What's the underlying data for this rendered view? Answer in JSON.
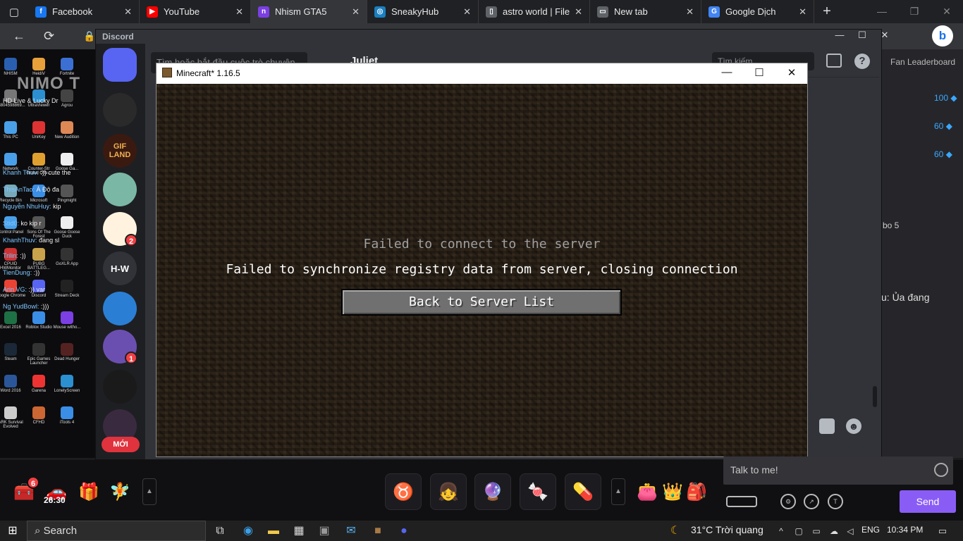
{
  "browser": {
    "tabs": [
      {
        "title": "Facebook",
        "icon": "facebook-icon",
        "color": "#1877f2",
        "glyph": "f"
      },
      {
        "title": "YouTube",
        "icon": "youtube-icon",
        "color": "#ff0000",
        "glyph": "▶"
      },
      {
        "title": "Nhism GTA5",
        "icon": "nimo-icon",
        "color": "#7b3fe4",
        "glyph": "n",
        "active": true
      },
      {
        "title": "SneakyHub",
        "icon": "sneakyhub-icon",
        "color": "#1a7fc1",
        "glyph": "◎"
      },
      {
        "title": "astro world | File",
        "icon": "document-icon",
        "color": "#5f6368",
        "glyph": "▯"
      },
      {
        "title": "New tab",
        "icon": "newtab-icon",
        "color": "#5f6368",
        "glyph": "▭"
      },
      {
        "title": "Google Dịch",
        "icon": "google-translate-icon",
        "color": "#4285f4",
        "glyph": "G"
      }
    ]
  },
  "nimo": {
    "logo": "NIMO T",
    "desktop_icons": [
      {
        "label": "NHISM",
        "c": "#2a5fb0"
      },
      {
        "label": "HeidiV",
        "c": "#e8a03a"
      },
      {
        "label": "Fortnite",
        "c": "#3b6fd4"
      },
      {
        "label": "z3804598869...",
        "c": "#777"
      },
      {
        "label": "UltraViewer",
        "c": "#2b8fd0"
      },
      {
        "label": "Agrou",
        "c": "#444"
      },
      {
        "label": "This PC",
        "c": "#4aa0e8"
      },
      {
        "label": "UniKey",
        "c": "#d33"
      },
      {
        "label": "New Audition",
        "c": "#d85"
      },
      {
        "label": "Network",
        "c": "#4aa0e8"
      },
      {
        "label": "Counter-Str Global Offe...",
        "c": "#e0a030"
      },
      {
        "label": "Goose Ga...",
        "c": "#eee"
      },
      {
        "label": "Recycle Bin",
        "c": "#7ab"
      },
      {
        "label": "Microsoft",
        "c": "#3a8ee6"
      },
      {
        "label": "Pingmight",
        "c": "#555"
      },
      {
        "label": "Control Panel",
        "c": "#4aa0e8"
      },
      {
        "label": "Sons Of The Forest",
        "c": "#555"
      },
      {
        "label": "Goose Goose Duck",
        "c": "#eee"
      },
      {
        "label": "CPUID HWMonitor",
        "c": "#c33"
      },
      {
        "label": "PUBG BATTLEG...",
        "c": "#c9a24b"
      },
      {
        "label": "GoXLR App",
        "c": "#333"
      },
      {
        "label": "Google Chrome",
        "c": "#e94335"
      },
      {
        "label": "Discord",
        "c": "#5865f2"
      },
      {
        "label": "Stream Deck",
        "c": "#222"
      },
      {
        "label": "Excel 2016",
        "c": "#1e7145"
      },
      {
        "label": "Roblox Studio",
        "c": "#3a8ee6"
      },
      {
        "label": "Mouse witho...",
        "c": "#7b3fe4"
      },
      {
        "label": "Steam",
        "c": "#1b2838"
      },
      {
        "label": "Epic Games Launcher",
        "c": "#333"
      },
      {
        "label": "Dead Hunger",
        "c": "#522"
      },
      {
        "label": "Word 2016",
        "c": "#2b579a"
      },
      {
        "label": "Garena",
        "c": "#e33"
      },
      {
        "label": "LonelyScreen",
        "c": "#2b8fd0"
      },
      {
        "label": "ARK Survival Evolved",
        "c": "#ccc"
      },
      {
        "label": "CFHD",
        "c": "#c63"
      },
      {
        "label": "iTools 4",
        "c": "#3a8ee6"
      }
    ],
    "chat": [
      {
        "user": "",
        "text": "HD Live & Lucky Dr"
      },
      {
        "user": "Khanh Thuv:",
        "text": ":)) cute the"
      },
      {
        "user": "ThisAnTao:",
        "text": "À Độ đa"
      },
      {
        "user": "Nguyễn NhuHuy:",
        "text": "kip"
      },
      {
        "user": "Stid0:",
        "text": "ko kip r"
      },
      {
        "user": "KhanhThuv:",
        "text": "đang sl"
      },
      {
        "user": "Trilin:",
        "text": ":))"
      },
      {
        "user": "TienDung:",
        "text": ":))"
      },
      {
        "user": "Arin VG:",
        "text": ":)) var"
      },
      {
        "user": "Ng YudBowl:",
        "text": ":)))"
      }
    ]
  },
  "rightpanel": {
    "title": "Fan Leaderboard",
    "values": [
      "100",
      "60",
      "60"
    ],
    "text1": "bo 5",
    "text2": "u: Ủa đang"
  },
  "discord": {
    "title": "Discord",
    "search_placeholder": "Tìm hoặc bắt đầu cuộc trò chuyện",
    "channel": "Juliet",
    "find_placeholder": "Tìm kiếm",
    "help": "?",
    "new_label": "MỚI",
    "servers": [
      {
        "name": "discord-home",
        "text": "",
        "bg": "#5865f2"
      },
      {
        "name": "valorant",
        "text": "",
        "bg": "#2a2a2a"
      },
      {
        "name": "gif-land",
        "text": "GIF LAND",
        "bg": "#3a1a10"
      },
      {
        "name": "minecraft-realm",
        "text": "",
        "bg": "#7bb7a5"
      },
      {
        "name": "orange-server",
        "text": "",
        "bg": "#fff3e0",
        "badge": "2"
      },
      {
        "name": "h-w",
        "text": "H-W",
        "bg": "#313338"
      },
      {
        "name": "blue-server",
        "text": "",
        "bg": "#2a7fd4"
      },
      {
        "name": "avatar-server",
        "text": "",
        "bg": "#6b4fb0",
        "badge": "1"
      },
      {
        "name": "arrow-server",
        "text": "",
        "bg": "#1a1a1a"
      },
      {
        "name": "anime-server",
        "text": "",
        "bg": "#3a2a40"
      }
    ]
  },
  "minecraft": {
    "window_title": "Minecraft* 1.16.5",
    "error_title": "Failed to connect to the server",
    "error_message": "Failed to synchronize registry data from server, closing connection",
    "back_button": "Back to Server List"
  },
  "gifts": {
    "chest_badge": "6",
    "timer": "26:30",
    "chat_placeholder": "Talk to me!",
    "send": "Send"
  },
  "taskbar": {
    "search": "Search",
    "weather": "31°C  Trời quang",
    "lang": "ENG",
    "time": "10:34 PM"
  }
}
